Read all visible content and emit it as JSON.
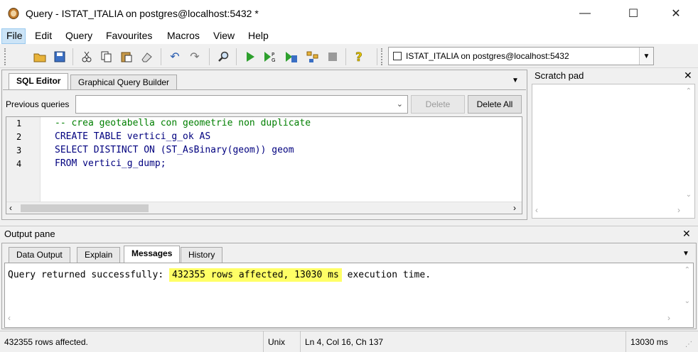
{
  "window": {
    "title": "Query - ISTAT_ITALIA on postgres@localhost:5432 *",
    "minimize": "—",
    "maximize": "☐",
    "close": "✕"
  },
  "menu": [
    {
      "label": "File"
    },
    {
      "label": "Edit"
    },
    {
      "label": "Query"
    },
    {
      "label": "Favourites"
    },
    {
      "label": "Macros"
    },
    {
      "label": "View"
    },
    {
      "label": "Help"
    }
  ],
  "toolbar": {
    "icons": [
      "open-icon",
      "save-icon",
      "cut-icon",
      "copy-icon",
      "paste-icon",
      "clear-icon",
      "undo-icon",
      "redo-icon",
      "find-icon",
      "execute-icon",
      "execute-pgscript-icon",
      "execute-to-file-icon",
      "explain-icon",
      "stop-icon",
      "help-icon"
    ],
    "connection": "ISTAT_ITALIA on postgres@localhost:5432"
  },
  "editor": {
    "tabs": [
      "SQL Editor",
      "Graphical Query Builder"
    ],
    "previous_queries_label": "Previous queries",
    "delete_label": "Delete",
    "delete_all_label": "Delete All",
    "line_numbers": [
      "1",
      "2",
      "3",
      "4"
    ],
    "lines": [
      "-- crea geotabella con geometrie non duplicate",
      "CREATE TABLE vertici_g_ok AS",
      "SELECT DISTINCT ON (ST_AsBinary(geom)) geom",
      "FROM vertici_g_dump;"
    ]
  },
  "scratch": {
    "title": "Scratch pad"
  },
  "output": {
    "title": "Output pane",
    "tabs": [
      "Data Output",
      "Explain",
      "Messages",
      "History"
    ],
    "message_prefix": "Query returned successfully: ",
    "message_highlight": "432355 rows affected, 13030 ms",
    "message_suffix": " execution time."
  },
  "status": {
    "rows": "432355 rows affected.",
    "line_ending": "Unix",
    "position": "Ln 4, Col 16, Ch 137",
    "time": "13030 ms"
  }
}
